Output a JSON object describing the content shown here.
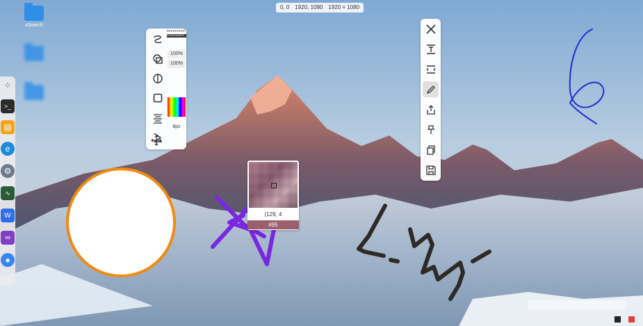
{
  "coordinate_readout": {
    "origin": "0, 0",
    "end_point": "1920, 1080",
    "size": "1920 × 1080"
  },
  "desktop": {
    "icons": [
      {
        "label": "zSearch",
        "icon": "folder-icon"
      },
      {
        "label": "",
        "icon": "folder-icon"
      },
      {
        "label": "",
        "icon": "folder-icon"
      }
    ]
  },
  "taskbar": {
    "apps": [
      {
        "name": "dots-app-icon",
        "color": "#333333"
      },
      {
        "name": "terminal-app-icon",
        "color": "#2b2b2b"
      },
      {
        "name": "file-manager-app-icon",
        "color": "#f3a31a"
      },
      {
        "name": "edge-browser-app-icon",
        "color": "#1c8bd8"
      },
      {
        "name": "settings-app-icon",
        "color": "#6d7b8d"
      },
      {
        "name": "system-monitor-app-icon",
        "color": "#2a5c3a"
      },
      {
        "name": "wps-app-icon",
        "color": "#2f6ee6"
      },
      {
        "name": "visual-studio-app-icon",
        "color": "#7f3fbf"
      },
      {
        "name": "browser-app-icon",
        "color": "#3a86f0"
      }
    ]
  },
  "left_toolbar": {
    "color_primary": "#FFFFFFFF",
    "color_secondary": "#333333FF",
    "opacity_1": "100%",
    "opacity_2": "100%",
    "pen_size": "8px",
    "tools": [
      "curve-icon",
      "shape-overlap-icon",
      "contrast-icon",
      "square-icon",
      "align-text-icon",
      "sum-icon",
      "move-icon"
    ]
  },
  "right_toolbar": {
    "tools": [
      "close-icon",
      "text-insert-icon",
      "expand-height-icon",
      "pen-icon",
      "share-icon",
      "pin-icon",
      "copy-icon",
      "save-icon"
    ],
    "active": "pen-icon"
  },
  "magnifier": {
    "coords": "(129, 4",
    "hex": "#95",
    "color": "#9b5e6e"
  },
  "annotations": {
    "circle_fill": "#ffffff",
    "circle_stroke": "#f08a14",
    "purple_stroke": "#7a27e0",
    "blue_stroke": "#1f2fd0",
    "dark_stroke": "#2e2a28"
  },
  "tray": {
    "colors": [
      "#222222",
      "#e04040"
    ]
  }
}
